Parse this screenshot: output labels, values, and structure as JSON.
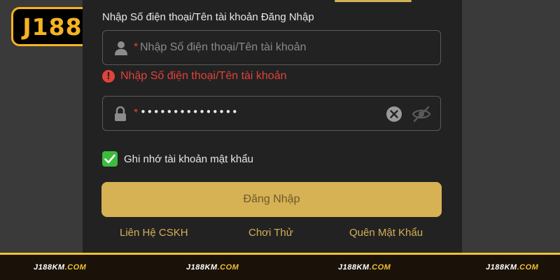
{
  "brand": {
    "logo_text": "J188",
    "accent": "#f5b321"
  },
  "login": {
    "title": "Nhập Số điện thoại/Tên tài khoản Đăng Nhập",
    "username": {
      "required_mark": "*",
      "placeholder": "Nhập Số điện thoại/Tên tài khoản",
      "icon": "user-icon"
    },
    "error": {
      "icon": "alert-icon",
      "text": "Nhập Số điện thoại/Tên tài khoản",
      "color": "#e0423c"
    },
    "password": {
      "required_mark": "*",
      "value": "•••••••••••••••",
      "icon": "lock-icon",
      "clear_icon": "clear-icon",
      "eye_icon": "eye-slash-icon"
    },
    "remember": {
      "label": "Ghi nhớ tài khoản mật khẩu",
      "checked": true
    },
    "submit_label": "Đăng Nhập",
    "links": {
      "support": "Liên Hệ CSKH",
      "try": "Chơi Thử",
      "forgot": "Quên Mật Khẩu"
    }
  },
  "footer": {
    "items": [
      {
        "name": "J188KM",
        "tld": ".COM"
      },
      {
        "name": "J188KM",
        "tld": ".COM"
      },
      {
        "name": "J188KM",
        "tld": ".COM"
      },
      {
        "name": "J188KM",
        "tld": ".COM"
      }
    ]
  }
}
